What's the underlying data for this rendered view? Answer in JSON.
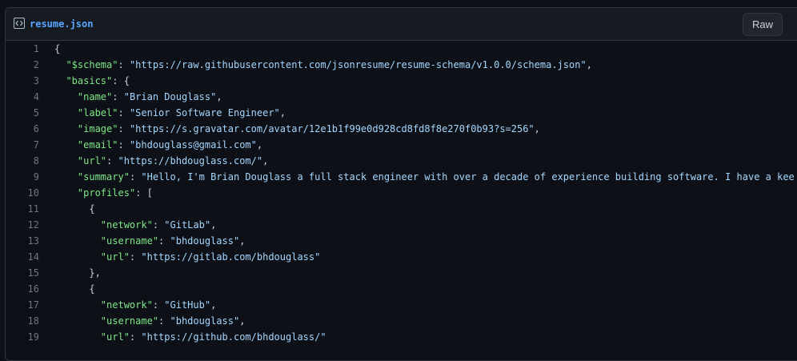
{
  "file": {
    "name": "resume.json",
    "raw_label": "Raw"
  },
  "lines": [
    {
      "num": "1",
      "indent": "",
      "parts": [
        [
          "pun",
          "{"
        ]
      ]
    },
    {
      "num": "2",
      "indent": "  ",
      "parts": [
        [
          "key",
          "\"$schema\""
        ],
        [
          "pun",
          ": "
        ],
        [
          "str",
          "\"https://raw.githubusercontent.com/jsonresume/resume-schema/v1.0.0/schema.json\""
        ],
        [
          "pun",
          ","
        ]
      ]
    },
    {
      "num": "3",
      "indent": "  ",
      "parts": [
        [
          "key",
          "\"basics\""
        ],
        [
          "pun",
          ": {"
        ]
      ]
    },
    {
      "num": "4",
      "indent": "    ",
      "parts": [
        [
          "key",
          "\"name\""
        ],
        [
          "pun",
          ": "
        ],
        [
          "str",
          "\"Brian Douglass\""
        ],
        [
          "pun",
          ","
        ]
      ]
    },
    {
      "num": "5",
      "indent": "    ",
      "parts": [
        [
          "key",
          "\"label\""
        ],
        [
          "pun",
          ": "
        ],
        [
          "str",
          "\"Senior Software Engineer\""
        ],
        [
          "pun",
          ","
        ]
      ]
    },
    {
      "num": "6",
      "indent": "    ",
      "parts": [
        [
          "key",
          "\"image\""
        ],
        [
          "pun",
          ": "
        ],
        [
          "str",
          "\"https://s.gravatar.com/avatar/12e1b1f99e0d928cd8fd8f8e270f0b93?s=256\""
        ],
        [
          "pun",
          ","
        ]
      ]
    },
    {
      "num": "7",
      "indent": "    ",
      "parts": [
        [
          "key",
          "\"email\""
        ],
        [
          "pun",
          ": "
        ],
        [
          "str",
          "\"bhdouglass@gmail.com\""
        ],
        [
          "pun",
          ","
        ]
      ]
    },
    {
      "num": "8",
      "indent": "    ",
      "parts": [
        [
          "key",
          "\"url\""
        ],
        [
          "pun",
          ": "
        ],
        [
          "str",
          "\"https://bhdouglass.com/\""
        ],
        [
          "pun",
          ","
        ]
      ]
    },
    {
      "num": "9",
      "indent": "    ",
      "parts": [
        [
          "key",
          "\"summary\""
        ],
        [
          "pun",
          ": "
        ],
        [
          "str",
          "\"Hello, I'm Brian Douglass a full stack engineer with over a decade of experience building software. I have a kee"
        ]
      ]
    },
    {
      "num": "10",
      "indent": "    ",
      "parts": [
        [
          "key",
          "\"profiles\""
        ],
        [
          "pun",
          ": ["
        ]
      ]
    },
    {
      "num": "11",
      "indent": "      ",
      "parts": [
        [
          "pun",
          "{"
        ]
      ]
    },
    {
      "num": "12",
      "indent": "        ",
      "parts": [
        [
          "key",
          "\"network\""
        ],
        [
          "pun",
          ": "
        ],
        [
          "str",
          "\"GitLab\""
        ],
        [
          "pun",
          ","
        ]
      ]
    },
    {
      "num": "13",
      "indent": "        ",
      "parts": [
        [
          "key",
          "\"username\""
        ],
        [
          "pun",
          ": "
        ],
        [
          "str",
          "\"bhdouglass\""
        ],
        [
          "pun",
          ","
        ]
      ]
    },
    {
      "num": "14",
      "indent": "        ",
      "parts": [
        [
          "key",
          "\"url\""
        ],
        [
          "pun",
          ": "
        ],
        [
          "str",
          "\"https://gitlab.com/bhdouglass\""
        ]
      ]
    },
    {
      "num": "15",
      "indent": "      ",
      "parts": [
        [
          "pun",
          "},"
        ]
      ]
    },
    {
      "num": "16",
      "indent": "      ",
      "parts": [
        [
          "pun",
          "{"
        ]
      ]
    },
    {
      "num": "17",
      "indent": "        ",
      "parts": [
        [
          "key",
          "\"network\""
        ],
        [
          "pun",
          ": "
        ],
        [
          "str",
          "\"GitHub\""
        ],
        [
          "pun",
          ","
        ]
      ]
    },
    {
      "num": "18",
      "indent": "        ",
      "parts": [
        [
          "key",
          "\"username\""
        ],
        [
          "pun",
          ": "
        ],
        [
          "str",
          "\"bhdouglass\""
        ],
        [
          "pun",
          ","
        ]
      ]
    },
    {
      "num": "19",
      "indent": "        ",
      "parts": [
        [
          "key",
          "\"url\""
        ],
        [
          "pun",
          ": "
        ],
        [
          "str",
          "\"https://github.com/bhdouglass/\""
        ]
      ]
    }
  ]
}
